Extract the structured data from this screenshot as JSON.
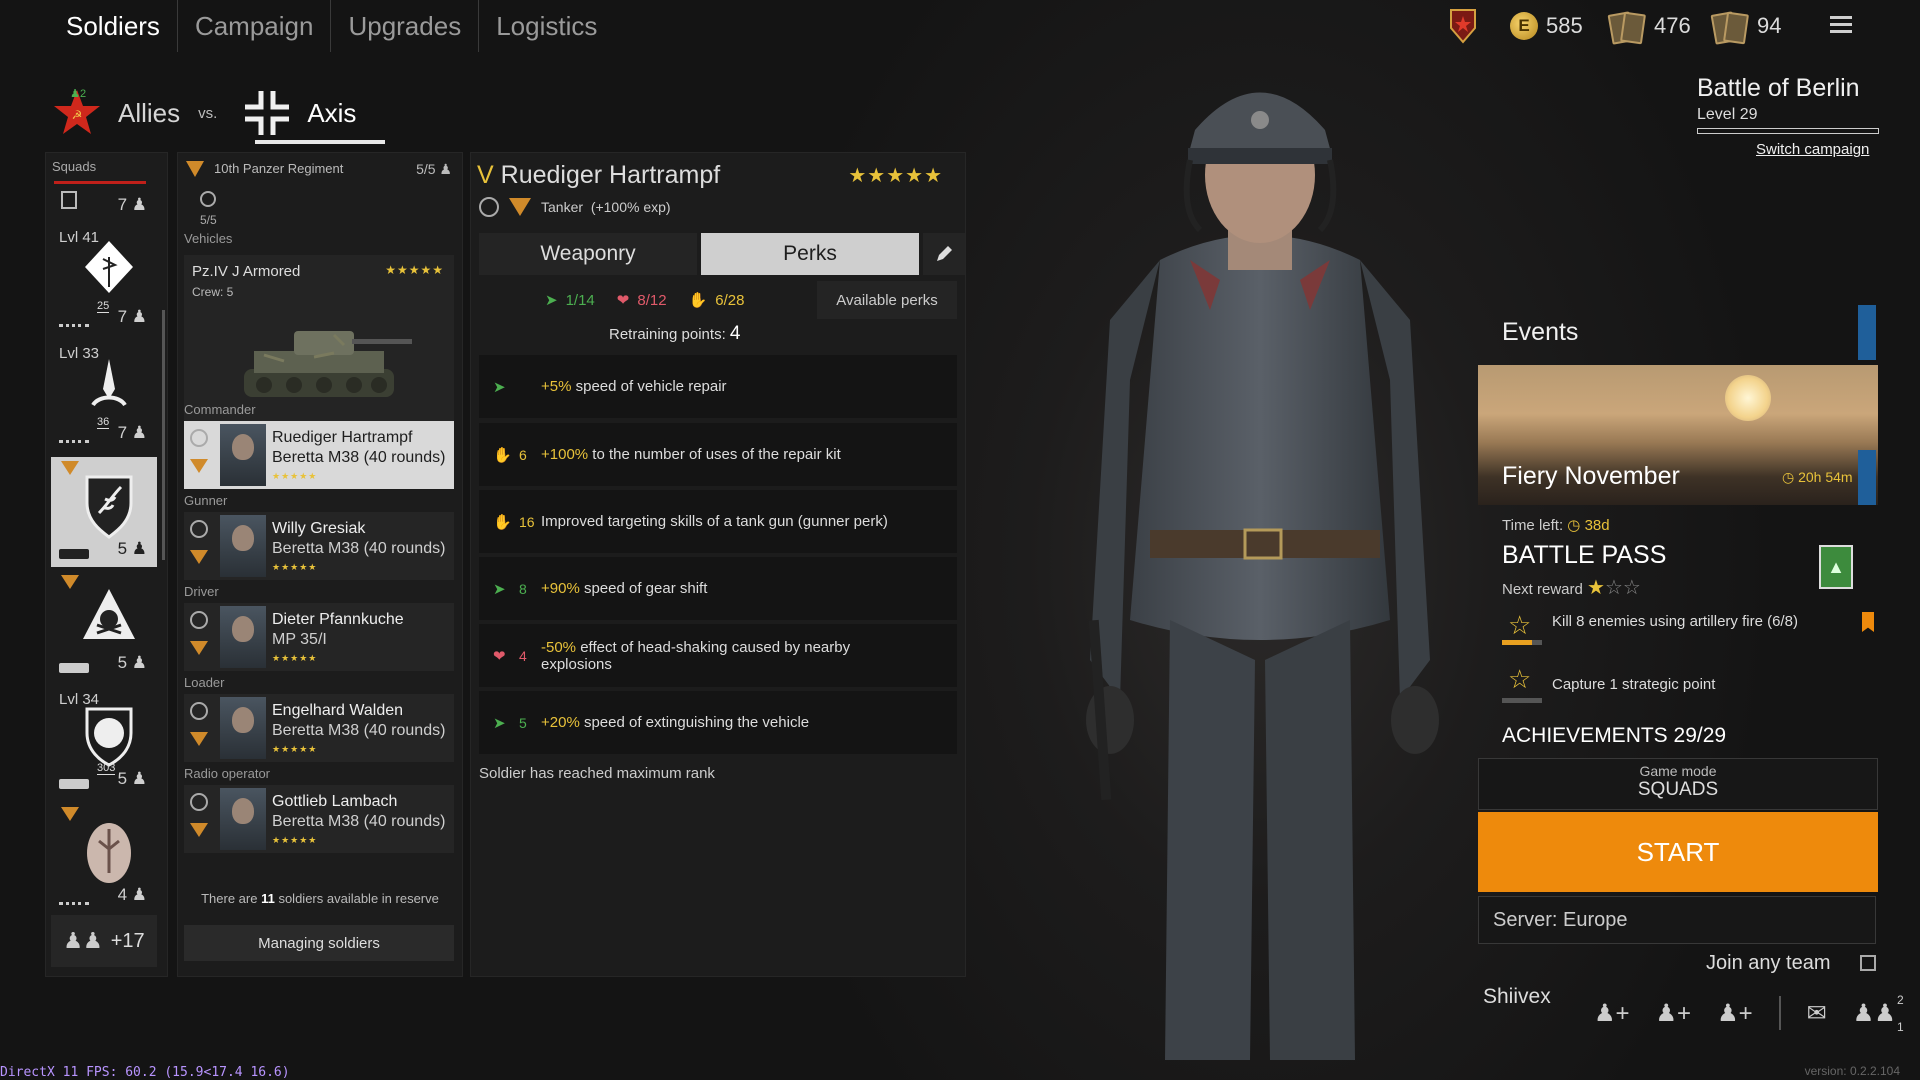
{
  "nav": {
    "tabs": [
      "Soldiers",
      "Campaign",
      "Upgrades",
      "Logistics"
    ]
  },
  "currencies": {
    "gold": "585",
    "cards_a": "476",
    "cards_b": "94",
    "gold_symbol": "E"
  },
  "factions": {
    "allies": "Allies",
    "vs": "vs.",
    "axis": "Axis",
    "online": "2"
  },
  "campaign": {
    "title": "Battle of Berlin",
    "level": "Level 29",
    "switch": "Switch campaign"
  },
  "squads": {
    "header": "Squads",
    "items": [
      {
        "lvl": "",
        "count": "7",
        "num": ""
      },
      {
        "lvl": "Lvl 41",
        "count": "7",
        "num": "25"
      },
      {
        "lvl": "Lvl 33",
        "count": "7",
        "num": "36"
      },
      {
        "lvl": "",
        "count": "5",
        "num": ""
      },
      {
        "lvl": "",
        "count": "5",
        "num": ""
      },
      {
        "lvl": "Lvl 34",
        "count": "5",
        "num": "303"
      },
      {
        "lvl": "",
        "count": "4",
        "num": ""
      }
    ],
    "extra": "+17"
  },
  "unit": {
    "name": "10th Panzer Regiment",
    "slots": "5/5",
    "crew_ratio": "5/5",
    "vehicles_label": "Vehicles",
    "vehicle": {
      "name": "Pz.IV J Armored",
      "crew": "Crew: 5",
      "stars": "★★★★★"
    },
    "roles": [
      {
        "role": "Commander",
        "name": "Ruediger Hartrampf",
        "weapon": "Beretta M38 (40 rounds)",
        "stars": "★★★★★"
      },
      {
        "role": "Gunner",
        "name": "Willy Gresiak",
        "weapon": "Beretta M38 (40 rounds)",
        "stars": "★★★★★"
      },
      {
        "role": "Driver",
        "name": "Dieter Pfannkuche",
        "weapon": "MP 35/I",
        "stars": "★★★★★"
      },
      {
        "role": "Loader",
        "name": "Engelhard Walden",
        "weapon": "Beretta M38 (40 rounds)",
        "stars": "★★★★★"
      },
      {
        "role": "Radio operator",
        "name": "Gottlieb Lambach",
        "weapon": "Beretta M38 (40 rounds)",
        "stars": "★★★★★"
      }
    ],
    "reserve_pre": "There are ",
    "reserve_num": "11",
    "reserve_post": " soldiers available in reserve",
    "manage": "Managing soldiers"
  },
  "soldier": {
    "rank": "V",
    "name": "Ruediger Hartrampf",
    "stars": "★★★★★",
    "class": "Tanker",
    "bonus": "(+100% exp)",
    "tabs": {
      "weaponry": "Weaponry",
      "perks": "Perks"
    },
    "stats": {
      "speed": "1/14",
      "vitality": "8/12",
      "utility": "6/28"
    },
    "available_perks": "Available perks",
    "retraining_label": "Retraining points:",
    "retraining_value": "4",
    "perks": [
      {
        "type": "speed",
        "cost": "",
        "hi": "+5%",
        "text": " speed of vehicle repair"
      },
      {
        "type": "utility",
        "cost": "6",
        "hi": "+100%",
        "text": " to the number of uses of the repair kit"
      },
      {
        "type": "utility",
        "cost": "16",
        "hi": "",
        "text": "Improved targeting skills of a tank gun (gunner perk)"
      },
      {
        "type": "speed",
        "cost": "8",
        "hi": "+90%",
        "text": " speed of gear shift"
      },
      {
        "type": "vitality",
        "cost": "4",
        "hi": "-50%",
        "text": " effect of head-shaking caused by nearby explosions"
      },
      {
        "type": "speed",
        "cost": "5",
        "hi": "+20%",
        "text": " speed of extinguishing the vehicle"
      }
    ],
    "max_rank": "Soldier has reached maximum rank"
  },
  "events": {
    "title": "Events",
    "event_name": "Fiery November",
    "event_time": "20h 54m",
    "time_left_label": "Time left:",
    "time_left": "38d",
    "battle_pass": "BATTLE PASS",
    "next_reward": "Next reward",
    "tasks": [
      {
        "text": "Kill 8 enemies using artillery fire",
        "progress": "(6/8)",
        "fraction": 0.75
      },
      {
        "text": "Capture 1 strategic point",
        "progress": "",
        "fraction": 0
      }
    ],
    "achievements": "ACHIEVEMENTS 29/29"
  },
  "play": {
    "mode_label": "Game mode",
    "mode": "SQUADS",
    "start": "START",
    "server": "Server: Europe",
    "join_any": "Join any team",
    "player": "Shiivex",
    "friends_badge_a": "2",
    "friends_badge_b": "1"
  },
  "footer": {
    "fps": "DirectX 11 FPS: 60.2 (15.9<17.4 16.6)",
    "version": "version: 0.2.2.104"
  },
  "colors": {
    "accent": "#ee8a0c",
    "star": "#e8c23a",
    "events_bar": "#1f5f9a",
    "red_star": "#d0281c"
  }
}
